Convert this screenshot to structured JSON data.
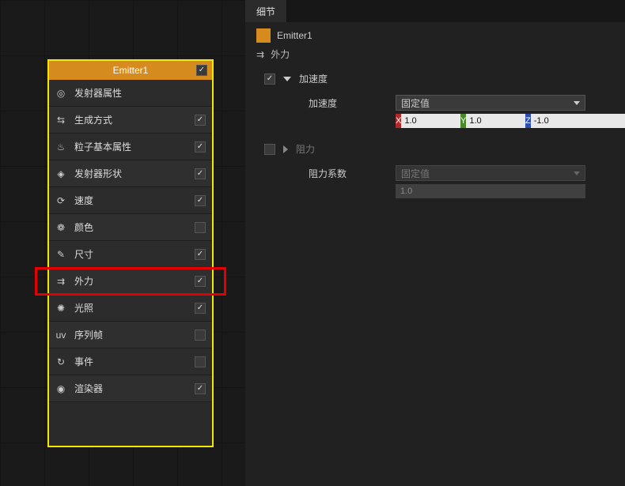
{
  "emitter": {
    "title": "Emitter1",
    "header_checked": true,
    "modules": [
      {
        "icon": "target-icon",
        "glyph": "◎",
        "label": "发射器属性",
        "checked": null
      },
      {
        "icon": "mode-icon",
        "glyph": "⇆",
        "label": "生成方式",
        "checked": true
      },
      {
        "icon": "fire-icon",
        "glyph": "♨",
        "label": "粒子基本属性",
        "checked": true
      },
      {
        "icon": "pin-icon",
        "glyph": "◈",
        "label": "发射器形状",
        "checked": true
      },
      {
        "icon": "speed-icon",
        "glyph": "⟳",
        "label": "速度",
        "checked": true
      },
      {
        "icon": "color-icon",
        "glyph": "❁",
        "label": "颜色",
        "checked": false
      },
      {
        "icon": "size-icon",
        "glyph": "✎",
        "label": "尺寸",
        "checked": true
      },
      {
        "icon": "force-icon",
        "glyph": "⇉",
        "label": "外力",
        "checked": true,
        "highlight": true
      },
      {
        "icon": "light-icon",
        "glyph": "✺",
        "label": "光照",
        "checked": true
      },
      {
        "icon": "uv-icon",
        "glyph": "uv",
        "label": "序列帧",
        "checked": false
      },
      {
        "icon": "event-icon",
        "glyph": "↻",
        "label": "事件",
        "checked": false
      },
      {
        "icon": "renderer-icon",
        "glyph": "◉",
        "label": "渲染器",
        "checked": true
      }
    ]
  },
  "details": {
    "tab_label": "细节",
    "object_name": "Emitter1",
    "path_icon": "⇉",
    "path_label": "外力",
    "sections": {
      "accel": {
        "enabled": true,
        "title": "加速度",
        "prop_label": "加速度",
        "mode": "固定值",
        "x": "1.0",
        "y": "1.0",
        "z": "-1.0"
      },
      "drag": {
        "enabled": false,
        "title": "阻力",
        "prop_label": "阻力系数",
        "mode": "固定值",
        "value": "1.0"
      }
    }
  }
}
